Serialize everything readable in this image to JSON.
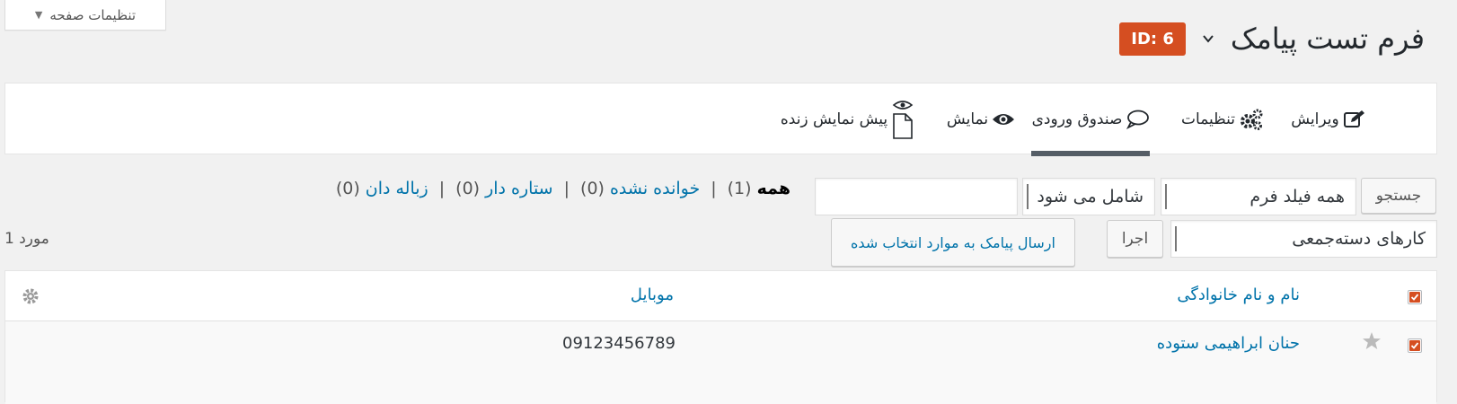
{
  "screen_options": {
    "label": "تنظیمات صفحه",
    "caret": "▼"
  },
  "header": {
    "title": "فرم تست پیامک",
    "id_badge": "ID: 6"
  },
  "tabs": [
    {
      "label": "ویرایش",
      "icon": "edit-icon"
    },
    {
      "label": "تنظیمات",
      "icon": "gears-icon"
    },
    {
      "label": "صندوق ورودی",
      "icon": "comment-icon",
      "active": true
    },
    {
      "label": "نمایش",
      "icon": "eye-icon"
    },
    {
      "label": "پیش نمایش زنده",
      "icon": "live-preview-icon"
    }
  ],
  "search": {
    "button": "جستجو",
    "field_select": "همه فیلد فرم",
    "operator_select": "شامل می شود",
    "value": ""
  },
  "filters": {
    "all_label": "همه",
    "all_count": "(1)",
    "unread_label": "خوانده نشده",
    "unread_count": "(0)",
    "starred_label": "ستاره دار",
    "starred_count": "(0)",
    "trash_label": "زباله دان",
    "trash_count": "(0)",
    "separator": "|"
  },
  "bulk": {
    "select": "کارهای دسته‌جمعی",
    "apply": "اجرا",
    "send_sms": "ارسال پیامک به موارد انتخاب شده"
  },
  "items_count": "1 مورد",
  "table": {
    "columns": [
      "نام و نام خانوادگی",
      "موبایل"
    ],
    "rows": [
      {
        "name": "حنان ابراهیمی ستوده",
        "mobile": "09123456789",
        "checked": true,
        "starred": false
      }
    ]
  },
  "colors": {
    "accent": "#d54e21",
    "link": "#0073aa",
    "checkbox": "#d54e21"
  }
}
